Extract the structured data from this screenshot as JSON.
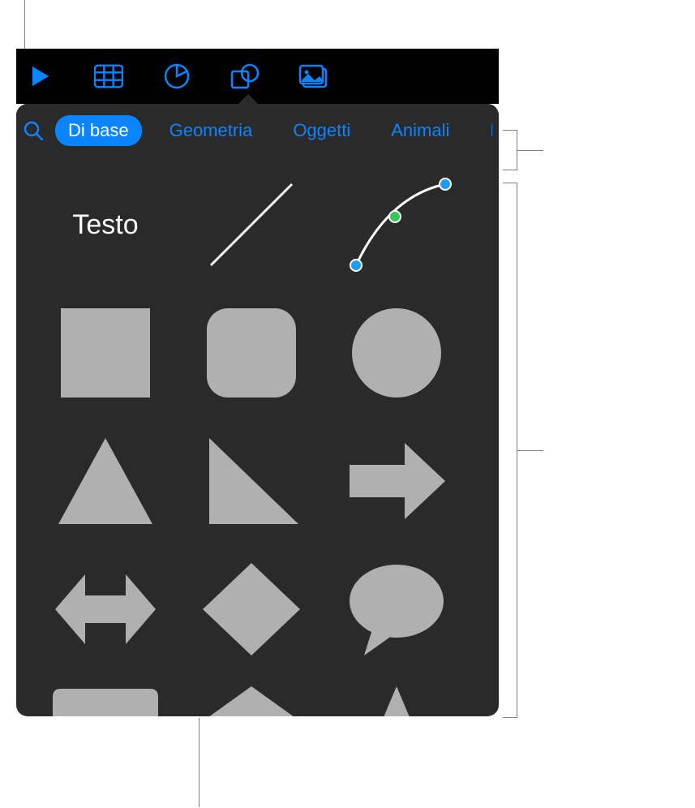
{
  "toolbar": {
    "icons": [
      {
        "name": "play-icon"
      },
      {
        "name": "table-icon"
      },
      {
        "name": "chart-icon"
      },
      {
        "name": "shape-icon"
      },
      {
        "name": "media-icon"
      }
    ]
  },
  "popover": {
    "categories": [
      {
        "label": "Di base",
        "active": true
      },
      {
        "label": "Geometria",
        "active": false
      },
      {
        "label": "Oggetti",
        "active": false
      },
      {
        "label": "Animali",
        "active": false
      },
      {
        "label": "N",
        "active": false
      }
    ],
    "text_shape_label": "Testo",
    "shapes": [
      {
        "name": "text-shape",
        "type": "text"
      },
      {
        "name": "line-shape",
        "type": "line"
      },
      {
        "name": "curve-shape",
        "type": "curve"
      },
      {
        "name": "square-shape",
        "type": "square"
      },
      {
        "name": "rounded-square-shape",
        "type": "rounded-square"
      },
      {
        "name": "circle-shape",
        "type": "circle"
      },
      {
        "name": "triangle-shape",
        "type": "triangle"
      },
      {
        "name": "right-triangle-shape",
        "type": "right-triangle"
      },
      {
        "name": "arrow-right-shape",
        "type": "arrow-right"
      },
      {
        "name": "arrow-double-shape",
        "type": "arrow-double"
      },
      {
        "name": "diamond-shape",
        "type": "diamond"
      },
      {
        "name": "speech-bubble-shape",
        "type": "speech-bubble"
      },
      {
        "name": "callout-shape",
        "type": "callout"
      },
      {
        "name": "pentagon-shape",
        "type": "pentagon"
      },
      {
        "name": "star-shape",
        "type": "star"
      }
    ]
  },
  "colors": {
    "shape_fill": "#b0b0b0",
    "accent": "#0a84ff",
    "curve_point_blue": "#1f9bff",
    "curve_point_green": "#34c759"
  }
}
